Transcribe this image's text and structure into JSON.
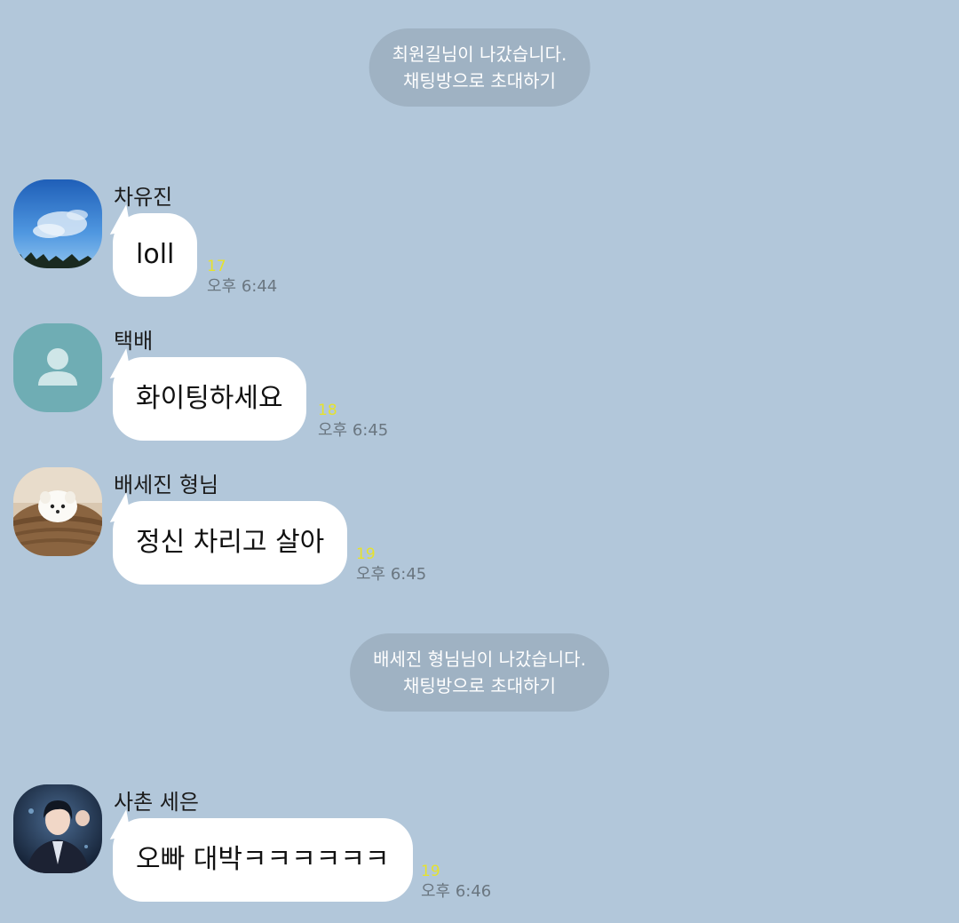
{
  "system_messages": [
    {
      "line1": "최원길님이 나갔습니다.",
      "line2": "채팅방으로 초대하기"
    },
    {
      "line1": "배세진 형님님이 나갔습니다.",
      "line2": "채팅방으로 초대하기"
    }
  ],
  "messages": [
    {
      "sender": "차유진",
      "text": "loll",
      "unread": "17",
      "time": "오후 6:44",
      "avatar": "sky-photo"
    },
    {
      "sender": "택배",
      "text": "화이팅하세요",
      "unread": "18",
      "time": "오후 6:45",
      "avatar": "default-person-icon"
    },
    {
      "sender": "배세진 형님",
      "text": "정신 차리고 살아",
      "unread": "19",
      "time": "오후 6:45",
      "avatar": "puppy-photo"
    },
    {
      "sender": "사촌 세은",
      "text": "오빠 대박ㅋㅋㅋㅋㅋㅋ",
      "unread": "19",
      "time": "오후 6:46",
      "avatar": "illustrated-man-photo"
    }
  ],
  "colors": {
    "background": "#b2c7da",
    "system_pill": "#9fb2c3",
    "bubble": "#ffffff",
    "unread": "#e6e22d",
    "time": "#6a7680",
    "default_avatar": "#6fadb4"
  }
}
